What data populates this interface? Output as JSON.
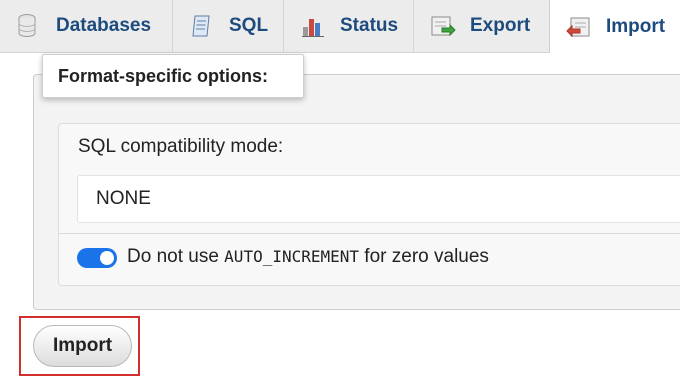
{
  "tabs": [
    {
      "label": "Databases",
      "icon": "database-icon"
    },
    {
      "label": "SQL",
      "icon": "sql-icon"
    },
    {
      "label": "Status",
      "icon": "status-chart-icon"
    },
    {
      "label": "Export",
      "icon": "export-icon"
    },
    {
      "label": "Import",
      "icon": "import-icon",
      "active": true
    }
  ],
  "tooltip": {
    "text": "Format-specific options:"
  },
  "options": {
    "compat_label": "SQL compatibility mode:",
    "compat_value": "NONE",
    "auto_increment_prefix": "Do not use ",
    "auto_increment_code": "AUTO_INCREMENT",
    "auto_increment_suffix": " for zero values",
    "auto_increment_enabled": true
  },
  "import_button": {
    "label": "Import"
  },
  "colors": {
    "tab_text": "#1d4b7e",
    "toggle_on": "#1a73e8",
    "highlight": "#d32f2f"
  }
}
